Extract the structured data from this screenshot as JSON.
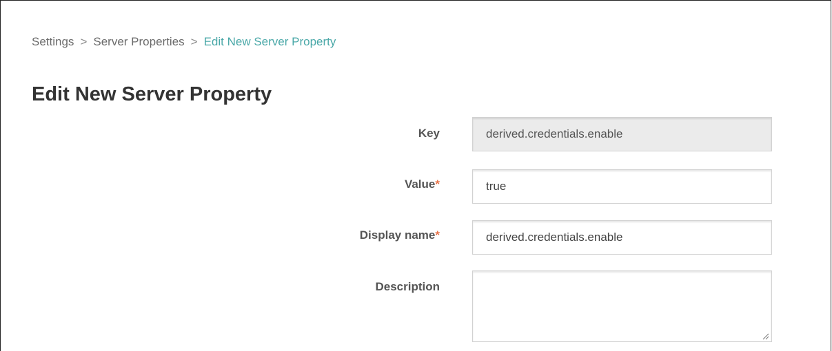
{
  "breadcrumb": {
    "items": [
      "Settings",
      "Server Properties"
    ],
    "separator": ">",
    "current": "Edit New Server Property"
  },
  "page": {
    "title": "Edit New Server Property"
  },
  "form": {
    "key": {
      "label": "Key",
      "value": "derived.credentials.enable",
      "readonly": true
    },
    "value": {
      "label": "Value",
      "required_mark": "*",
      "value": "true"
    },
    "display_name": {
      "label": "Display name",
      "required_mark": "*",
      "value": "derived.credentials.enable"
    },
    "description": {
      "label": "Description",
      "value": ""
    }
  },
  "colors": {
    "breadcrumb_current": "#4aa8a8",
    "required_mark": "#e8744a",
    "readonly_field_bg": "#ebebeb"
  }
}
